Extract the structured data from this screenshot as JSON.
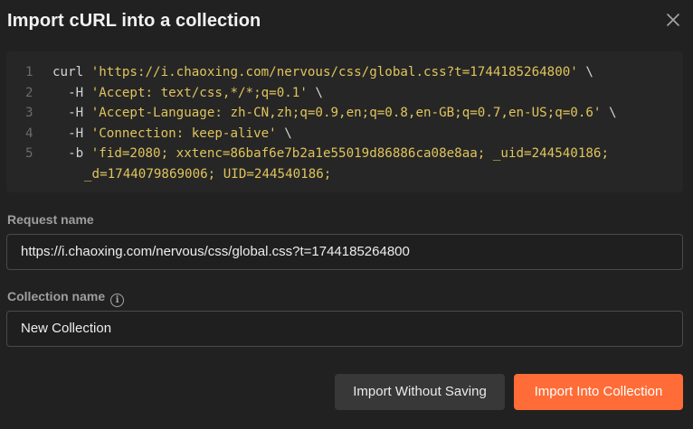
{
  "dialog": {
    "title": "Import cURL into a collection",
    "close_icon": "close-icon"
  },
  "code": {
    "lines": [
      {
        "number": "1",
        "parts": [
          {
            "t": "curl ",
            "c": "plain"
          },
          {
            "t": "'https://i.chaoxing.com/nervous/css/global.css?t=1744185264800'",
            "c": "str"
          },
          {
            "t": " \\",
            "c": "plain"
          }
        ]
      },
      {
        "number": "2",
        "parts": [
          {
            "t": "  -H ",
            "c": "plain"
          },
          {
            "t": "'Accept: text/css,*/*;q=0.1'",
            "c": "str"
          },
          {
            "t": " \\",
            "c": "plain"
          }
        ]
      },
      {
        "number": "3",
        "parts": [
          {
            "t": "  -H ",
            "c": "plain"
          },
          {
            "t": "'Accept-Language: zh-CN,zh;q=0.9,en;q=0.8,en-GB;q=0.7,en-US;q=0.6'",
            "c": "str"
          },
          {
            "t": " \\",
            "c": "plain"
          }
        ]
      },
      {
        "number": "4",
        "parts": [
          {
            "t": "  -H ",
            "c": "plain"
          },
          {
            "t": "'Connection: keep-alive'",
            "c": "str"
          },
          {
            "t": " \\",
            "c": "plain"
          }
        ]
      },
      {
        "number": "5",
        "parts": [
          {
            "t": "  -b ",
            "c": "plain"
          },
          {
            "t": "'fid=2080; xxtenc=86baf6e7b2a1e55019d86886ca08e8aa; _uid=244540186;",
            "c": "str"
          }
        ]
      },
      {
        "number": "",
        "cont": true,
        "parts": [
          {
            "t": "_d=1744079869006; UID=244540186;",
            "c": "str"
          }
        ]
      }
    ]
  },
  "request_name": {
    "label": "Request name",
    "value": "https://i.chaoxing.com/nervous/css/global.css?t=1744185264800"
  },
  "collection_name": {
    "label": "Collection name",
    "info_icon": "info-icon",
    "value": "New Collection"
  },
  "buttons": {
    "secondary": "Import Without Saving",
    "primary": "Import Into Collection"
  },
  "colors": {
    "background": "#212121",
    "code_background": "#262626",
    "string": "#e0c45c",
    "primary_button": "#ff6c37",
    "secondary_button": "#383838"
  }
}
